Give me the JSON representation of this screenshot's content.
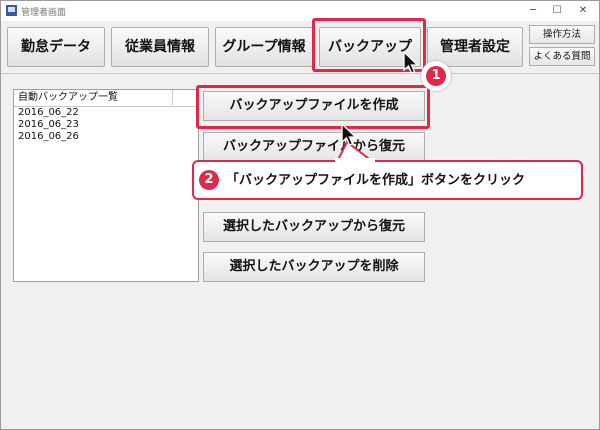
{
  "window": {
    "title": "管理者画面",
    "controls": {
      "minimize": "─",
      "maximize": "☐",
      "close": "✕"
    }
  },
  "nav": {
    "buttons": [
      {
        "id": "attendance",
        "label": "勤怠データ"
      },
      {
        "id": "employees",
        "label": "従業員情報"
      },
      {
        "id": "groups",
        "label": "グループ情報"
      },
      {
        "id": "backup",
        "label": "バックアップ"
      },
      {
        "id": "admin",
        "label": "管理者設定"
      }
    ],
    "help": {
      "manual": "操作方法",
      "faq": "よくある質問"
    }
  },
  "backup_list": {
    "header": "自動バックアップ一覧",
    "items": [
      "2016_06_22",
      "2016_06_23",
      "2016_06_26"
    ]
  },
  "actions": {
    "create": "バックアップファイルを作成",
    "restore_file": "バックアップファイルから復元",
    "restore_selected": "選択したバックアップから復元",
    "delete_selected": "選択したバックアップを削除"
  },
  "annotations": {
    "step1_badge": "1",
    "step2_badge": "2",
    "step2_text": "「バックアップファイルを作成」ボタンをクリック",
    "highlight_color": "#e0294a"
  }
}
